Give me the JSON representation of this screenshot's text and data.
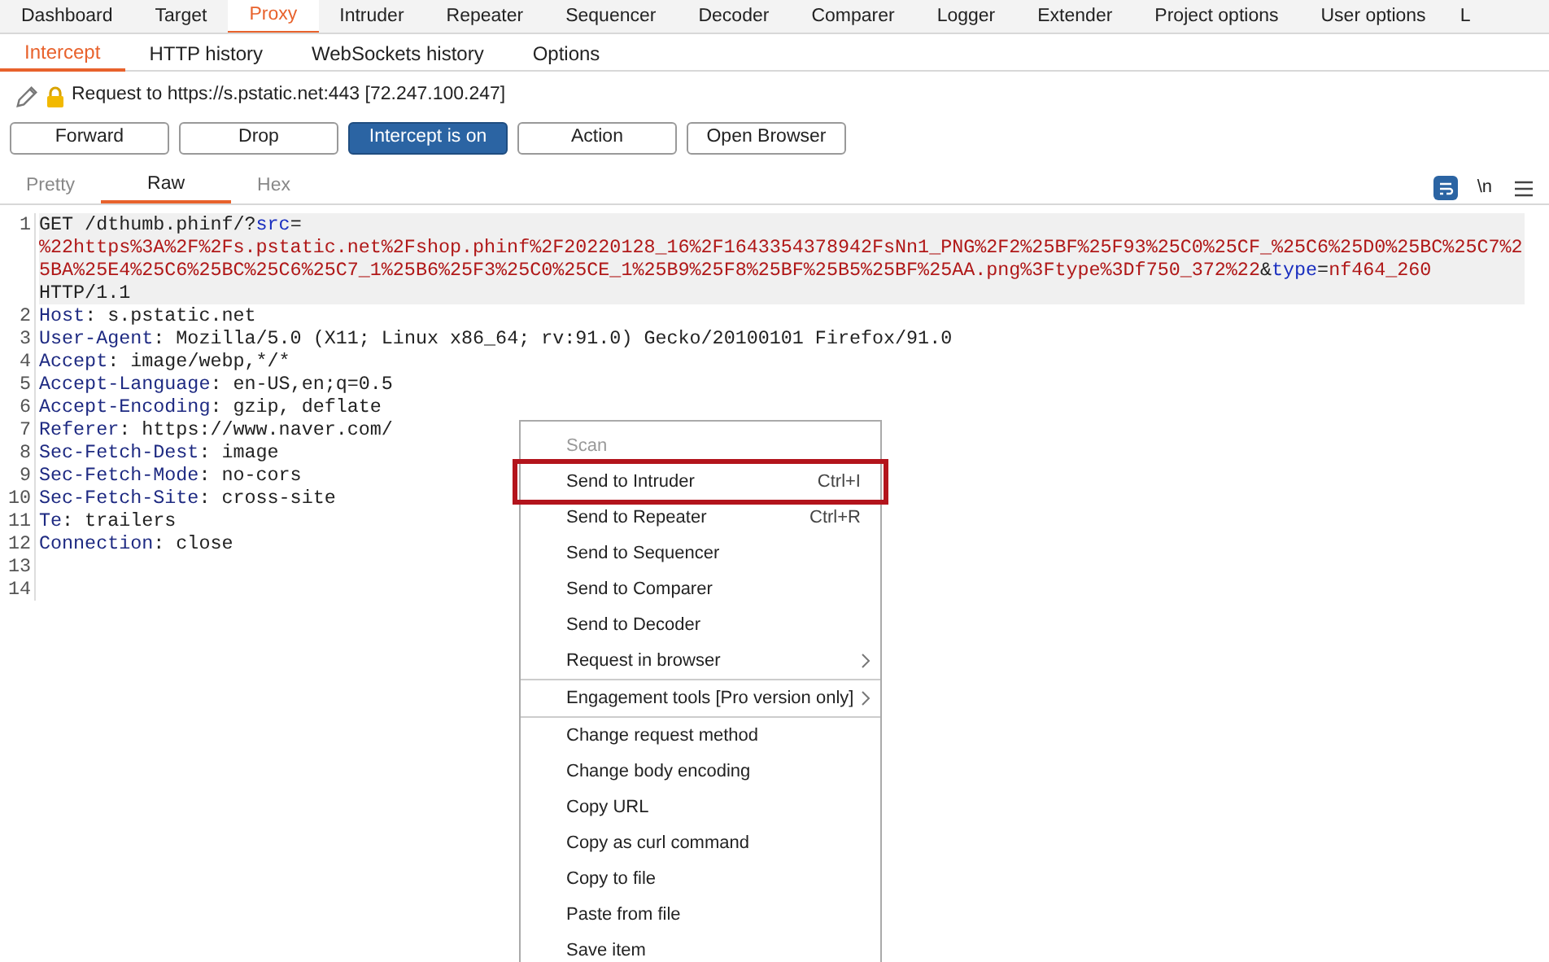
{
  "main_tabs": [
    {
      "label": "Dashboard",
      "selected": false
    },
    {
      "label": "Target",
      "selected": false
    },
    {
      "label": "Proxy",
      "selected": true
    },
    {
      "label": "Intruder",
      "selected": false
    },
    {
      "label": "Repeater",
      "selected": false
    },
    {
      "label": "Sequencer",
      "selected": false
    },
    {
      "label": "Decoder",
      "selected": false
    },
    {
      "label": "Comparer",
      "selected": false
    },
    {
      "label": "Logger",
      "selected": false
    },
    {
      "label": "Extender",
      "selected": false
    },
    {
      "label": "Project options",
      "selected": false
    },
    {
      "label": "User options",
      "selected": false
    },
    {
      "label": "L",
      "selected": false
    }
  ],
  "sub_tabs": [
    {
      "label": "Intercept",
      "selected": true
    },
    {
      "label": "HTTP history",
      "selected": false
    },
    {
      "label": "WebSockets history",
      "selected": false
    },
    {
      "label": "Options",
      "selected": false
    }
  ],
  "request_info": "Request to https://s.pstatic.net:443 [72.247.100.247]",
  "buttons": [
    {
      "label": "Forward",
      "on": false
    },
    {
      "label": "Drop",
      "on": false
    },
    {
      "label": "Intercept is on",
      "on": true
    },
    {
      "label": "Action",
      "on": false
    },
    {
      "label": "Open Browser",
      "on": false
    }
  ],
  "editor_tabs": [
    {
      "label": "Pretty",
      "selected": false
    },
    {
      "label": "Raw",
      "selected": true
    },
    {
      "label": "Hex",
      "selected": false
    }
  ],
  "editor_tools": {
    "newline_toggle": "\\n"
  },
  "lines": [
    {
      "number": "1",
      "segments": [
        {
          "text": "GET /dthumb.phinf/?",
          "kind": "plain"
        },
        {
          "text": "src",
          "kind": "name"
        },
        {
          "text": "=",
          "kind": "plain"
        },
        {
          "text": "%22https%3A%2F%2Fs.pstatic.net%2Fshop.phinf%2F20220128_16%2F1643354378942FsNn1_PNG%2F2%25BF%25F93%25C0%25CF_%25C6%25D0%25BC%25C7%25BA%25E4%25C6%25BC%25C6%25C7_1%25B6%25F3%25C0%25CE_1%25B9%25F8%25BF%25B5%25BF%25AA.png%3Ftype%3Df750_372%22",
          "kind": "value",
          "new_row": true
        },
        {
          "text": "&",
          "kind": "plain"
        },
        {
          "text": "type",
          "kind": "name"
        },
        {
          "text": "=",
          "kind": "plain"
        },
        {
          "text": "nf464_260",
          "kind": "value"
        },
        {
          "text": "HTTP/1.1",
          "kind": "plain",
          "new_row": true
        }
      ]
    },
    {
      "number": "2",
      "segments": [
        {
          "text": "Host",
          "kind": "header"
        },
        {
          "text": ": s.pstatic.net",
          "kind": "plain"
        }
      ]
    },
    {
      "number": "3",
      "segments": [
        {
          "text": "User-Agent",
          "kind": "header"
        },
        {
          "text": ": Mozilla/5.0 (X11; Linux x86_64; rv:91.0) Gecko/20100101 Firefox/91.0",
          "kind": "plain"
        }
      ]
    },
    {
      "number": "4",
      "segments": [
        {
          "text": "Accept",
          "kind": "header"
        },
        {
          "text": ": image/webp,*/*",
          "kind": "plain"
        }
      ]
    },
    {
      "number": "5",
      "segments": [
        {
          "text": "Accept-Language",
          "kind": "header"
        },
        {
          "text": ": en-US,en;q=0.5",
          "kind": "plain"
        }
      ]
    },
    {
      "number": "6",
      "segments": [
        {
          "text": "Accept-Encoding",
          "kind": "header"
        },
        {
          "text": ": gzip, deflate",
          "kind": "plain"
        }
      ]
    },
    {
      "number": "7",
      "segments": [
        {
          "text": "Referer",
          "kind": "header"
        },
        {
          "text": ": https://www.naver.com/",
          "kind": "plain"
        }
      ]
    },
    {
      "number": "8",
      "segments": [
        {
          "text": "Sec-Fetch-Dest",
          "kind": "header"
        },
        {
          "text": ": image",
          "kind": "plain"
        }
      ]
    },
    {
      "number": "9",
      "segments": [
        {
          "text": "Sec-Fetch-Mode",
          "kind": "header"
        },
        {
          "text": ": no-cors",
          "kind": "plain"
        }
      ]
    },
    {
      "number": "10",
      "segments": [
        {
          "text": "Sec-Fetch-Site",
          "kind": "header"
        },
        {
          "text": ": cross-site",
          "kind": "plain"
        }
      ]
    },
    {
      "number": "11",
      "segments": [
        {
          "text": "Te",
          "kind": "header"
        },
        {
          "text": ": trailers",
          "kind": "plain"
        }
      ]
    },
    {
      "number": "12",
      "segments": [
        {
          "text": "Connection",
          "kind": "header"
        },
        {
          "text": ": close",
          "kind": "plain"
        }
      ]
    },
    {
      "number": "13"
    },
    {
      "number": "14"
    }
  ],
  "context_menu": [
    {
      "kind": "item",
      "label": "Scan",
      "disabled": true,
      "highlighted": false
    },
    {
      "kind": "item",
      "label": "Send to Intruder",
      "shortcut": "Ctrl+I",
      "disabled": false,
      "highlighted": true
    },
    {
      "kind": "item",
      "label": "Send to Repeater",
      "shortcut": "Ctrl+R",
      "disabled": false,
      "highlighted": false
    },
    {
      "kind": "item",
      "label": "Send to Sequencer",
      "disabled": false,
      "highlighted": false
    },
    {
      "kind": "item",
      "label": "Send to Comparer",
      "disabled": false,
      "highlighted": false
    },
    {
      "kind": "item",
      "label": "Send to Decoder",
      "disabled": false,
      "highlighted": false
    },
    {
      "kind": "submenu",
      "label": "Request in browser",
      "disabled": false,
      "highlighted": false
    },
    {
      "kind": "separator"
    },
    {
      "kind": "submenu",
      "label": "Engagement tools [Pro version only]",
      "disabled": false,
      "highlighted": false
    },
    {
      "kind": "separator"
    },
    {
      "kind": "item",
      "label": "Change request method",
      "disabled": false,
      "highlighted": false
    },
    {
      "kind": "item",
      "label": "Change body encoding",
      "disabled": false,
      "highlighted": false
    },
    {
      "kind": "item",
      "label": "Copy URL",
      "disabled": false,
      "highlighted": false
    },
    {
      "kind": "item",
      "label": "Copy as curl command",
      "disabled": false,
      "highlighted": false
    },
    {
      "kind": "item",
      "label": "Copy to file",
      "disabled": false,
      "highlighted": false
    },
    {
      "kind": "item",
      "label": "Paste from file",
      "disabled": false,
      "highlighted": false
    },
    {
      "kind": "item",
      "label": "Save item",
      "disabled": false,
      "highlighted": false
    }
  ]
}
